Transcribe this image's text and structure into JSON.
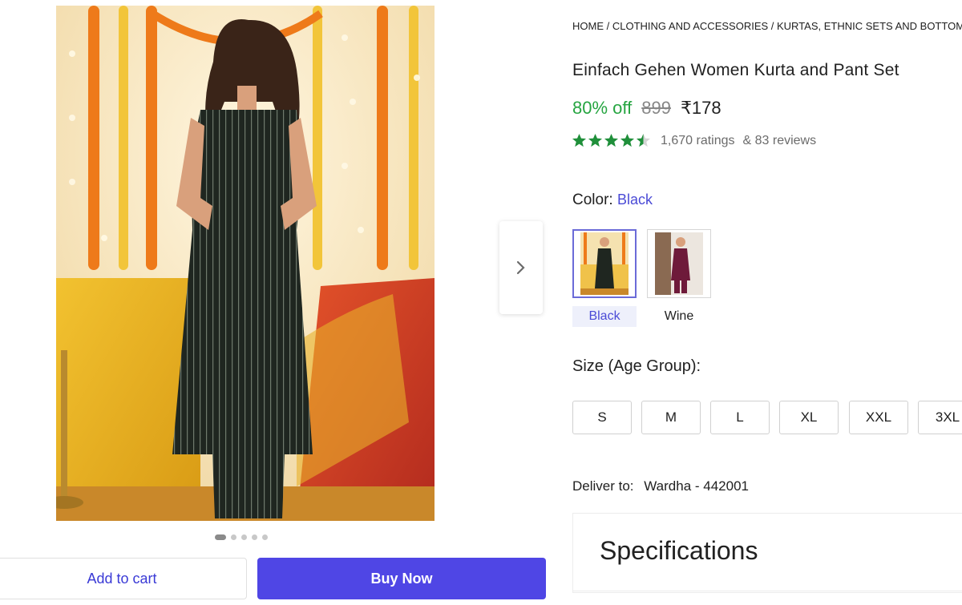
{
  "breadcrumb": "HOME / CLOTHING AND ACCESSORIES / KURTAS, ETHNIC SETS AND BOTTOMS",
  "product": {
    "title": "Einfach Gehen Women Kurta and Pant Set",
    "discount": "80% off",
    "mrp": "899",
    "price": "₹178",
    "rating_value": 4.5,
    "rating_max": 5,
    "ratings_text": "1,670 ratings",
    "reviews_text": "& 83 reviews"
  },
  "color": {
    "label": "Color:",
    "selected": "Black",
    "options": [
      {
        "name": "Black",
        "selected": true
      },
      {
        "name": "Wine",
        "selected": false
      }
    ]
  },
  "size": {
    "label": "Size (Age Group):",
    "options": [
      "S",
      "M",
      "L",
      "XL",
      "XXL",
      "3XL"
    ]
  },
  "delivery": {
    "label": "Deliver to:",
    "location": "Wardha - 442001"
  },
  "specifications": {
    "title": "Specifications"
  },
  "gallery": {
    "image_count": 5,
    "active_index": 0
  },
  "actions": {
    "add_to_cart": "Add to cart",
    "buy_now": "Buy Now"
  },
  "colors": {
    "accent": "#4f46e5",
    "discount": "#26a541",
    "star": "#1f8f3a",
    "link": "#4a4ad6"
  },
  "icons": {
    "next": "chevron-right-icon",
    "star": "star-icon"
  }
}
